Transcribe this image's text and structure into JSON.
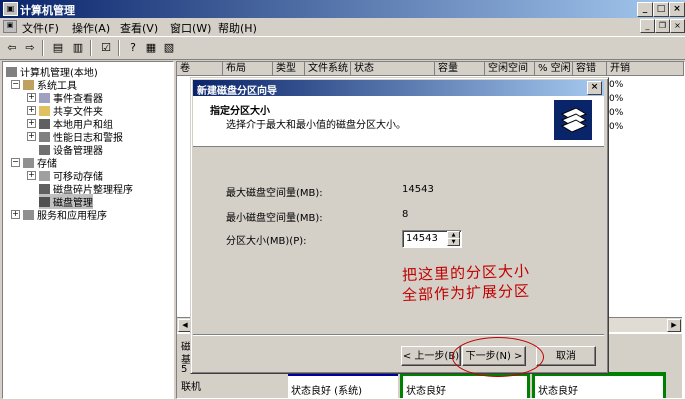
{
  "window": {
    "title": "计算机管理",
    "close": "×",
    "min": "_",
    "max": "□"
  },
  "menu": [
    "文件(F)",
    "操作(A)",
    "查看(V)",
    "窗口(W)",
    "帮助(H)"
  ],
  "tree": {
    "root": "计算机管理(本地)",
    "items": [
      {
        "label": "系统工具",
        "level": 1
      },
      {
        "label": "事件查看器",
        "level": 2
      },
      {
        "label": "共享文件夹",
        "level": 2
      },
      {
        "label": "本地用户和组",
        "level": 2
      },
      {
        "label": "性能日志和警报",
        "level": 2
      },
      {
        "label": "设备管理器",
        "level": 2
      },
      {
        "label": "存储",
        "level": 1
      },
      {
        "label": "可移动存储",
        "level": 2
      },
      {
        "label": "磁盘碎片整理程序",
        "level": 2
      },
      {
        "label": "磁盘管理",
        "level": 2
      },
      {
        "label": "服务和应用程序",
        "level": 1
      }
    ]
  },
  "columns": [
    "卷",
    "布局",
    "类型",
    "文件系统",
    "状态",
    "容量",
    "空闲空间",
    "% 空闲",
    "容错",
    "开销"
  ],
  "percent_values": [
    "0%",
    "0%",
    "0%",
    "0%"
  ],
  "disk_panel": {
    "labels": [
      "磁",
      "基",
      "5",
      "联机"
    ],
    "status1": "状态良好 (系统)",
    "status2": "状态良好",
    "status3": "状态良好"
  },
  "dialog": {
    "title": "新建磁盘分区向导",
    "close": "×",
    "heading": "指定分区大小",
    "subheading": "选择介于最大和最小值的磁盘分区大小。",
    "max_label": "最大磁盘空间量(MB):",
    "max_value": "14543",
    "min_label": "最小磁盘空间量(MB):",
    "min_value": "8",
    "size_label": "分区大小(MB)(P):",
    "size_value": "14543",
    "back_button": "< 上一步(B)",
    "next_button": "下一步(N) >",
    "cancel_button": "取消"
  },
  "annotation": {
    "line1": "把这里的分区大小",
    "line2": "全部作为扩展分区"
  }
}
